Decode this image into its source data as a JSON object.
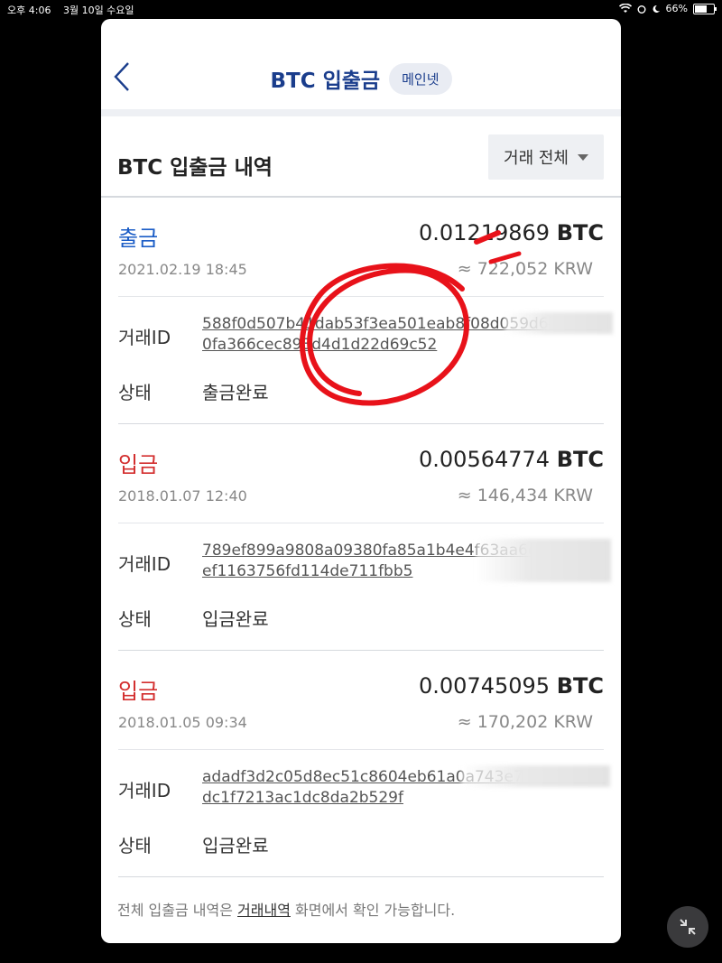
{
  "statusbar": {
    "time": "오후 4:06",
    "date": "3월 10일 수요일",
    "battery": "66%"
  },
  "nav": {
    "title": "BTC 입출금",
    "badge": "메인넷"
  },
  "section": {
    "title": "BTC 입출금 내역",
    "filter": "거래 전체"
  },
  "labels": {
    "txid": "거래ID",
    "status": "상태"
  },
  "transactions": [
    {
      "type": "출금",
      "amount": "0.01219869",
      "unit": "BTC",
      "date": "2021.02.19 18:45",
      "krw": "≈ 722,052 KRW",
      "txid": "588f0d507b41dab53f3ea501eab8f08d059d6d6a7 50fa366cec893d4d1d22d69c52",
      "status": "출금완료"
    },
    {
      "type": "입금",
      "amount": "0.00564774",
      "unit": "BTC",
      "date": "2018.01.07 12:40",
      "krw": "≈ 146,434 KRW",
      "txid": "789ef899a9808a09380fa85a1b4e4f63aa6d6a3 660ef1163756fd114de711fbb5",
      "status": "입금완료"
    },
    {
      "type": "입금",
      "amount": "0.00745095",
      "unit": "BTC",
      "date": "2018.01.05 09:34",
      "krw": "≈ 170,202 KRW",
      "txid": "adadf3d2c05d8ec51c8604eb61a0a743e72b8 4ab87dc1f7213ac1dc8da2b529f",
      "status": "입금완료"
    }
  ],
  "footer": {
    "prefix": "전체 입출금 내역은 ",
    "link": "거래내역",
    "suffix": " 화면에서 확인 가능합니다."
  },
  "colors": {
    "withdraw": "#1a5cc6",
    "deposit": "#d32f2f",
    "nav_title": "#1a3d8c"
  }
}
